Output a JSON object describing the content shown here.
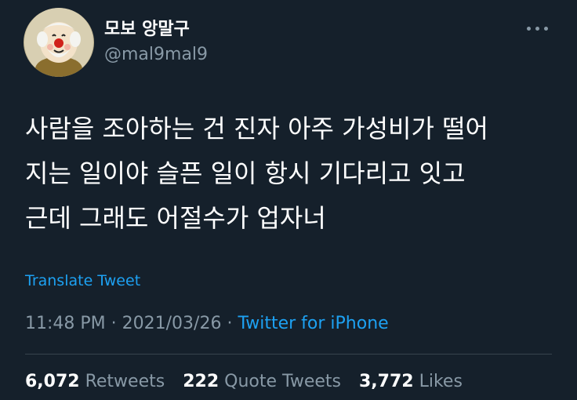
{
  "tweet": {
    "author": {
      "display_name": "모보 앙말구",
      "handle": "@mal9mal9",
      "avatar_icon": "clown-avatar"
    },
    "more_icon": "more-horizontal-icon",
    "text_lines": [
      "사람을 조아하는 건 진자 아주 가성비가 떨어",
      "지는 일이야 슬픈 일이 항시 기다리고 잇고",
      "근데 그래도 어절수가 업자너"
    ],
    "translate_label": "Translate Tweet",
    "timestamp": {
      "time": "11:48 PM",
      "separator": " · ",
      "date": "2021/03/26",
      "separator2": " · ",
      "source": "Twitter for iPhone"
    },
    "stats": {
      "retweets_count": "6,072",
      "retweets_label": "Retweets",
      "quotes_count": "222",
      "quotes_label": "Quote Tweets",
      "likes_count": "3,772",
      "likes_label": "Likes"
    }
  },
  "colors": {
    "background": "#15202b",
    "text": "#ffffff",
    "muted": "#8899a6",
    "accent": "#1da1f2",
    "divider": "#38444d"
  }
}
